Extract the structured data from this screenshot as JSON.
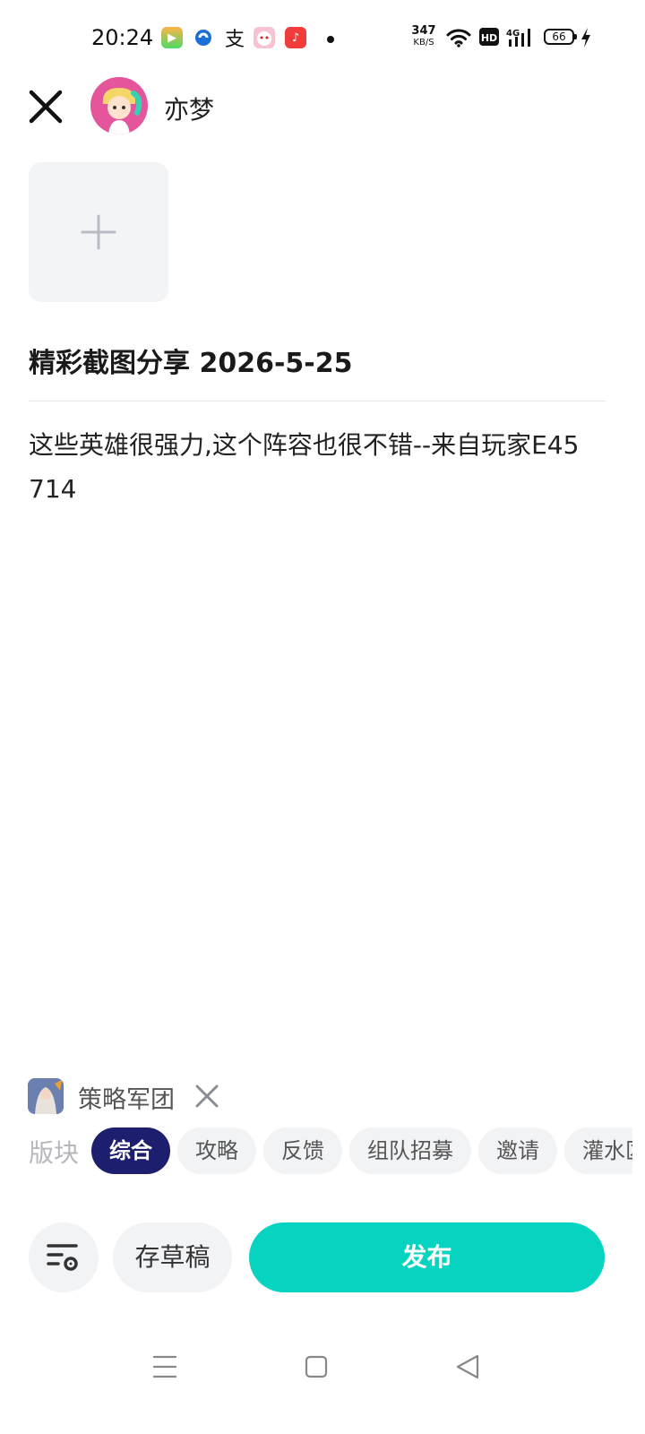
{
  "status_bar": {
    "time": "20:24",
    "network_speed_value": "347",
    "network_speed_unit": "KB/S",
    "battery_level": "66",
    "apps": [
      "video-app-icon",
      "bank-app-icon",
      "alipay-icon",
      "mascot-app-icon",
      "music-app-icon"
    ],
    "alipay_glyph": "支",
    "indicators": [
      "wifi-icon",
      "hd-icon",
      "4g-signal-icon",
      "battery-icon",
      "charging-icon"
    ]
  },
  "header": {
    "username": "亦梦"
  },
  "post": {
    "title": "精彩截图分享 2026-5-25",
    "body": "这些英雄很强力,这个阵容也很不错--来自玩家E45714"
  },
  "community": {
    "name": "策略军团"
  },
  "sections": {
    "label": "版块",
    "selected": "综合",
    "items": [
      "综合",
      "攻略",
      "反馈",
      "组队招募",
      "邀请",
      "灌水区"
    ]
  },
  "actions": {
    "draft_label": "存草稿",
    "publish_label": "发布"
  },
  "colors": {
    "accent": "#06d4c0",
    "chip_active": "#1e1e6e",
    "chip_bg": "#f2f3f5"
  }
}
